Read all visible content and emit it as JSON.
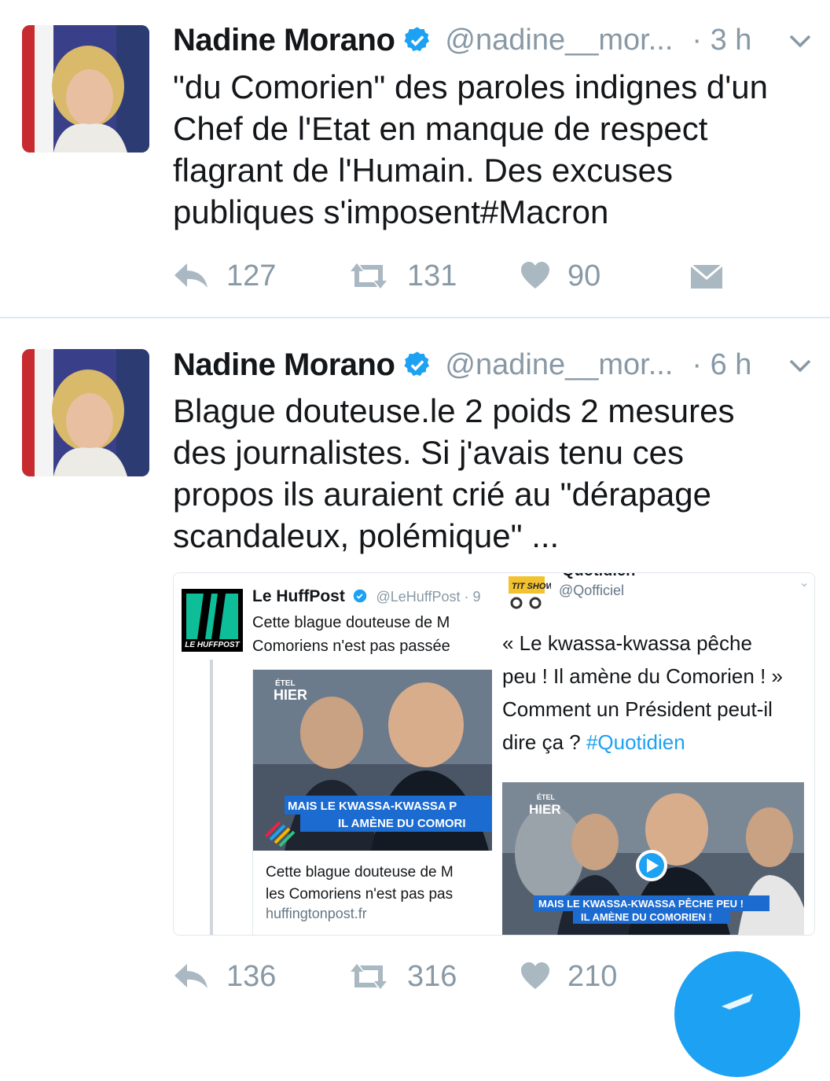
{
  "colors": {
    "accent": "#1da1f2",
    "secondary": "#8899a6",
    "icon": "#aab8c2",
    "separator": "#e1e8ed"
  },
  "icons": [
    "verified-badge-icon",
    "chevron-down-icon",
    "reply-icon",
    "retweet-icon",
    "heart-icon",
    "direct-message-icon",
    "play-icon",
    "compose-icon"
  ],
  "tweets": [
    {
      "author": "Nadine Morano",
      "handle": "@nadine__mor...",
      "time": "· 3 h",
      "text_lines": [
        "\"du Comorien\" des paroles indignes d'un",
        "Chef de l'Etat en manque de respect",
        "flagrant de l'Humain. Des excuses",
        "publiques s'imposent#Macron"
      ],
      "replies": "127",
      "retweets": "131",
      "likes": "90"
    },
    {
      "author": "Nadine Morano",
      "handle": "@nadine__mor...",
      "time": "· 6 h",
      "text_lines": [
        "Blague douteuse.le 2 poids 2 mesures",
        "des journalistes. Si j'avais tenu ces",
        "propos ils auraient crié au \"dérapage",
        "scandaleux, polémique\" ..."
      ],
      "replies": "136",
      "retweets": "316",
      "likes": "210"
    }
  ],
  "quoted_left": {
    "logo_text": "LE HUFFPOST",
    "name": "Le HuffPost",
    "handle": "@LeHuffPost · 9",
    "text_lines": [
      "Cette blague douteuse de M",
      "Comoriens n'est pas passée"
    ],
    "image_tag": "ÉTEL",
    "image_tag2": "HIER",
    "image_caption_1": "MAIS LE KWASSA-KWASSA P",
    "image_caption_2": "IL AMÈNE DU COMORI",
    "card_lines": [
      "Cette blague douteuse de M",
      "les Comoriens n'est pas pas"
    ],
    "card_domain": "huffingtonpost.fr"
  },
  "quoted_right": {
    "avatar_text": "TIT SHOW",
    "name": "Quotidien",
    "handle": "@Qofficiel",
    "text_line_1": "« Le kwassa-kwassa pêche",
    "text_line_2": "peu ! Il amène du Comorien ! »",
    "text_line_3": "Comment un Président peut-il",
    "text_line_4_pre": "dire ça ? ",
    "hashtag": "#Quotidien",
    "image_tag": "ÉTEL",
    "image_tag2": "HIER",
    "image_caption_1": "MAIS LE KWASSA-KWASSA PÊCHE PEU !",
    "image_caption_2": "IL AMÈNE DU COMORIEN !"
  }
}
